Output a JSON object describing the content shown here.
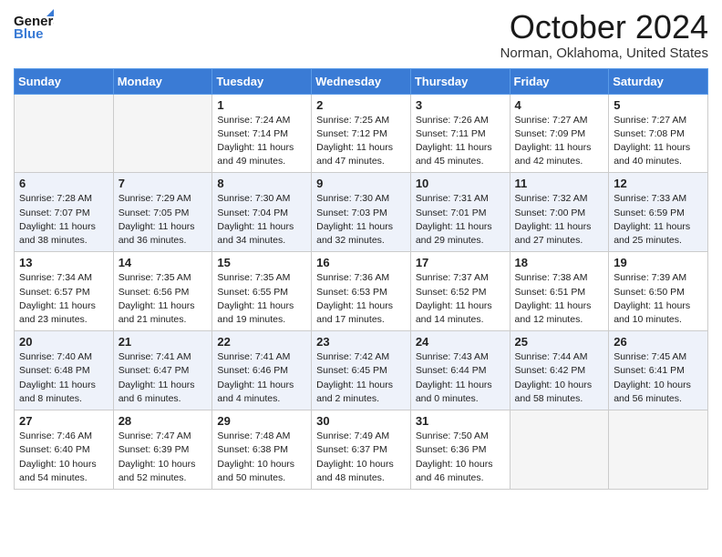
{
  "header": {
    "logo_line1": "General",
    "logo_line2": "Blue",
    "month": "October 2024",
    "location": "Norman, Oklahoma, United States"
  },
  "days_of_week": [
    "Sunday",
    "Monday",
    "Tuesday",
    "Wednesday",
    "Thursday",
    "Friday",
    "Saturday"
  ],
  "weeks": [
    [
      {
        "num": "",
        "sunrise": "",
        "sunset": "",
        "daylight": ""
      },
      {
        "num": "",
        "sunrise": "",
        "sunset": "",
        "daylight": ""
      },
      {
        "num": "1",
        "sunrise": "Sunrise: 7:24 AM",
        "sunset": "Sunset: 7:14 PM",
        "daylight": "Daylight: 11 hours and 49 minutes."
      },
      {
        "num": "2",
        "sunrise": "Sunrise: 7:25 AM",
        "sunset": "Sunset: 7:12 PM",
        "daylight": "Daylight: 11 hours and 47 minutes."
      },
      {
        "num": "3",
        "sunrise": "Sunrise: 7:26 AM",
        "sunset": "Sunset: 7:11 PM",
        "daylight": "Daylight: 11 hours and 45 minutes."
      },
      {
        "num": "4",
        "sunrise": "Sunrise: 7:27 AM",
        "sunset": "Sunset: 7:09 PM",
        "daylight": "Daylight: 11 hours and 42 minutes."
      },
      {
        "num": "5",
        "sunrise": "Sunrise: 7:27 AM",
        "sunset": "Sunset: 7:08 PM",
        "daylight": "Daylight: 11 hours and 40 minutes."
      }
    ],
    [
      {
        "num": "6",
        "sunrise": "Sunrise: 7:28 AM",
        "sunset": "Sunset: 7:07 PM",
        "daylight": "Daylight: 11 hours and 38 minutes."
      },
      {
        "num": "7",
        "sunrise": "Sunrise: 7:29 AM",
        "sunset": "Sunset: 7:05 PM",
        "daylight": "Daylight: 11 hours and 36 minutes."
      },
      {
        "num": "8",
        "sunrise": "Sunrise: 7:30 AM",
        "sunset": "Sunset: 7:04 PM",
        "daylight": "Daylight: 11 hours and 34 minutes."
      },
      {
        "num": "9",
        "sunrise": "Sunrise: 7:30 AM",
        "sunset": "Sunset: 7:03 PM",
        "daylight": "Daylight: 11 hours and 32 minutes."
      },
      {
        "num": "10",
        "sunrise": "Sunrise: 7:31 AM",
        "sunset": "Sunset: 7:01 PM",
        "daylight": "Daylight: 11 hours and 29 minutes."
      },
      {
        "num": "11",
        "sunrise": "Sunrise: 7:32 AM",
        "sunset": "Sunset: 7:00 PM",
        "daylight": "Daylight: 11 hours and 27 minutes."
      },
      {
        "num": "12",
        "sunrise": "Sunrise: 7:33 AM",
        "sunset": "Sunset: 6:59 PM",
        "daylight": "Daylight: 11 hours and 25 minutes."
      }
    ],
    [
      {
        "num": "13",
        "sunrise": "Sunrise: 7:34 AM",
        "sunset": "Sunset: 6:57 PM",
        "daylight": "Daylight: 11 hours and 23 minutes."
      },
      {
        "num": "14",
        "sunrise": "Sunrise: 7:35 AM",
        "sunset": "Sunset: 6:56 PM",
        "daylight": "Daylight: 11 hours and 21 minutes."
      },
      {
        "num": "15",
        "sunrise": "Sunrise: 7:35 AM",
        "sunset": "Sunset: 6:55 PM",
        "daylight": "Daylight: 11 hours and 19 minutes."
      },
      {
        "num": "16",
        "sunrise": "Sunrise: 7:36 AM",
        "sunset": "Sunset: 6:53 PM",
        "daylight": "Daylight: 11 hours and 17 minutes."
      },
      {
        "num": "17",
        "sunrise": "Sunrise: 7:37 AM",
        "sunset": "Sunset: 6:52 PM",
        "daylight": "Daylight: 11 hours and 14 minutes."
      },
      {
        "num": "18",
        "sunrise": "Sunrise: 7:38 AM",
        "sunset": "Sunset: 6:51 PM",
        "daylight": "Daylight: 11 hours and 12 minutes."
      },
      {
        "num": "19",
        "sunrise": "Sunrise: 7:39 AM",
        "sunset": "Sunset: 6:50 PM",
        "daylight": "Daylight: 11 hours and 10 minutes."
      }
    ],
    [
      {
        "num": "20",
        "sunrise": "Sunrise: 7:40 AM",
        "sunset": "Sunset: 6:48 PM",
        "daylight": "Daylight: 11 hours and 8 minutes."
      },
      {
        "num": "21",
        "sunrise": "Sunrise: 7:41 AM",
        "sunset": "Sunset: 6:47 PM",
        "daylight": "Daylight: 11 hours and 6 minutes."
      },
      {
        "num": "22",
        "sunrise": "Sunrise: 7:41 AM",
        "sunset": "Sunset: 6:46 PM",
        "daylight": "Daylight: 11 hours and 4 minutes."
      },
      {
        "num": "23",
        "sunrise": "Sunrise: 7:42 AM",
        "sunset": "Sunset: 6:45 PM",
        "daylight": "Daylight: 11 hours and 2 minutes."
      },
      {
        "num": "24",
        "sunrise": "Sunrise: 7:43 AM",
        "sunset": "Sunset: 6:44 PM",
        "daylight": "Daylight: 11 hours and 0 minutes."
      },
      {
        "num": "25",
        "sunrise": "Sunrise: 7:44 AM",
        "sunset": "Sunset: 6:42 PM",
        "daylight": "Daylight: 10 hours and 58 minutes."
      },
      {
        "num": "26",
        "sunrise": "Sunrise: 7:45 AM",
        "sunset": "Sunset: 6:41 PM",
        "daylight": "Daylight: 10 hours and 56 minutes."
      }
    ],
    [
      {
        "num": "27",
        "sunrise": "Sunrise: 7:46 AM",
        "sunset": "Sunset: 6:40 PM",
        "daylight": "Daylight: 10 hours and 54 minutes."
      },
      {
        "num": "28",
        "sunrise": "Sunrise: 7:47 AM",
        "sunset": "Sunset: 6:39 PM",
        "daylight": "Daylight: 10 hours and 52 minutes."
      },
      {
        "num": "29",
        "sunrise": "Sunrise: 7:48 AM",
        "sunset": "Sunset: 6:38 PM",
        "daylight": "Daylight: 10 hours and 50 minutes."
      },
      {
        "num": "30",
        "sunrise": "Sunrise: 7:49 AM",
        "sunset": "Sunset: 6:37 PM",
        "daylight": "Daylight: 10 hours and 48 minutes."
      },
      {
        "num": "31",
        "sunrise": "Sunrise: 7:50 AM",
        "sunset": "Sunset: 6:36 PM",
        "daylight": "Daylight: 10 hours and 46 minutes."
      },
      {
        "num": "",
        "sunrise": "",
        "sunset": "",
        "daylight": ""
      },
      {
        "num": "",
        "sunrise": "",
        "sunset": "",
        "daylight": ""
      }
    ]
  ]
}
